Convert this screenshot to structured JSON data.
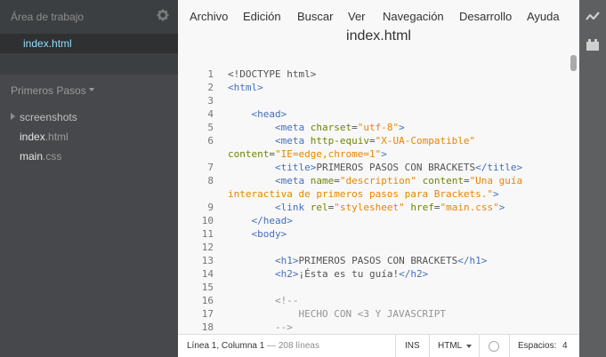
{
  "sidebar": {
    "working_tree_title": "Área de trabajo",
    "working_files": [
      "index.html"
    ],
    "project_title": "Primeros Pasos",
    "tree": [
      {
        "name": "screenshots",
        "ext": "",
        "type": "folder"
      },
      {
        "name": "index",
        "ext": ".html",
        "type": "file"
      },
      {
        "name": "main",
        "ext": ".css",
        "type": "file"
      }
    ]
  },
  "menu": [
    "Archivo",
    "Edición",
    "Buscar",
    "Ver",
    "Navegación",
    "Desarrollo",
    "Ayuda"
  ],
  "document_title": "index.html",
  "editor": {
    "line_numbers": [
      "1",
      "2",
      "3",
      "4",
      "5",
      "6",
      "",
      "7",
      "8",
      "",
      "9",
      "10",
      "11",
      "12",
      "13",
      "14",
      "15",
      "16",
      "17",
      "18"
    ]
  },
  "status": {
    "position": "Línea 1, Columna 1",
    "separator": " — ",
    "line_count": "208 líneas",
    "mode": "INS",
    "language": "HTML",
    "indent": "Espacios:",
    "indent_size": "4"
  },
  "colors": {
    "tag": "#446fbd",
    "attribute": "#6d8600",
    "value": "#e88501",
    "comment": "#949494",
    "selection_text": "#8fddff"
  },
  "icons": [
    "gear-icon",
    "live-preview-icon",
    "extension-manager-icon"
  ]
}
